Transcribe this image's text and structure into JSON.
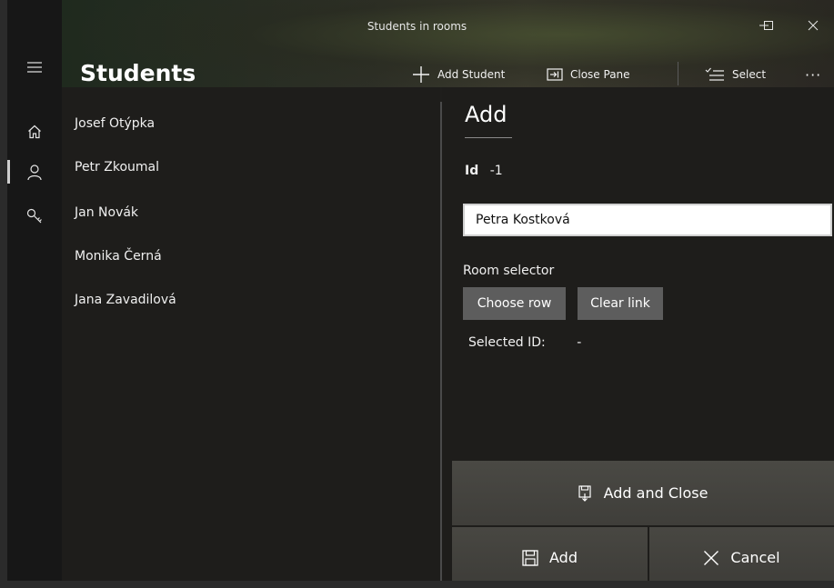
{
  "window": {
    "title": "Students in rooms"
  },
  "header": {
    "title": "Students",
    "commands": {
      "add_student": "Add Student",
      "close_pane": "Close Pane",
      "select": "Select",
      "more": "···"
    }
  },
  "nav": {
    "items": [
      {
        "icon": "hamburger-icon"
      },
      {
        "icon": "home-icon"
      },
      {
        "icon": "person-icon"
      },
      {
        "icon": "key-icon"
      }
    ]
  },
  "students": [
    {
      "name": "Josef Otýpka"
    },
    {
      "name": "Petr Zkoumal"
    },
    {
      "name": "Jan Novák"
    },
    {
      "name": "Monika Černá"
    },
    {
      "name": "Jana Zavadilová"
    }
  ],
  "pane": {
    "title": "Add",
    "id_label": "Id",
    "id_value": "-1",
    "name_value": "Petra Kostková",
    "room_selector_label": "Room selector",
    "choose_row": "Choose row",
    "clear_link": "Clear link",
    "selected_id_label": "Selected ID:",
    "selected_id_value": "-"
  },
  "actions": {
    "add_and_close": "Add and Close",
    "add": "Add",
    "cancel": "Cancel"
  }
}
